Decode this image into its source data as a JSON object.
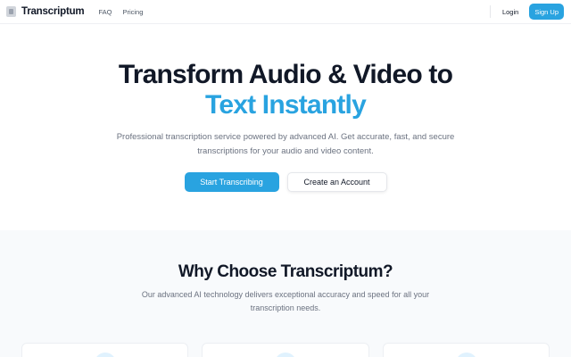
{
  "header": {
    "brand": "Transcriptum",
    "logo_icon": "document-icon",
    "nav": [
      {
        "label": "FAQ"
      },
      {
        "label": "Pricing"
      }
    ],
    "login_label": "Login",
    "signup_label": "Sign Up"
  },
  "hero": {
    "title_line1": "Transform Audio & Video to",
    "title_line2": "Text Instantly",
    "subtitle": "Professional transcription service powered by advanced AI. Get accurate, fast, and secure transcriptions for your audio and video content.",
    "primary_cta": "Start Transcribing",
    "secondary_cta": "Create an Account"
  },
  "features": {
    "title": "Why Choose Transcriptum?",
    "subtitle": "Our advanced AI technology delivers exceptional accuracy and speed for all your transcription needs."
  },
  "colors": {
    "accent": "#29a3e0",
    "heading": "#111827",
    "muted": "#6b7280",
    "section_bg": "#f8fafc"
  }
}
